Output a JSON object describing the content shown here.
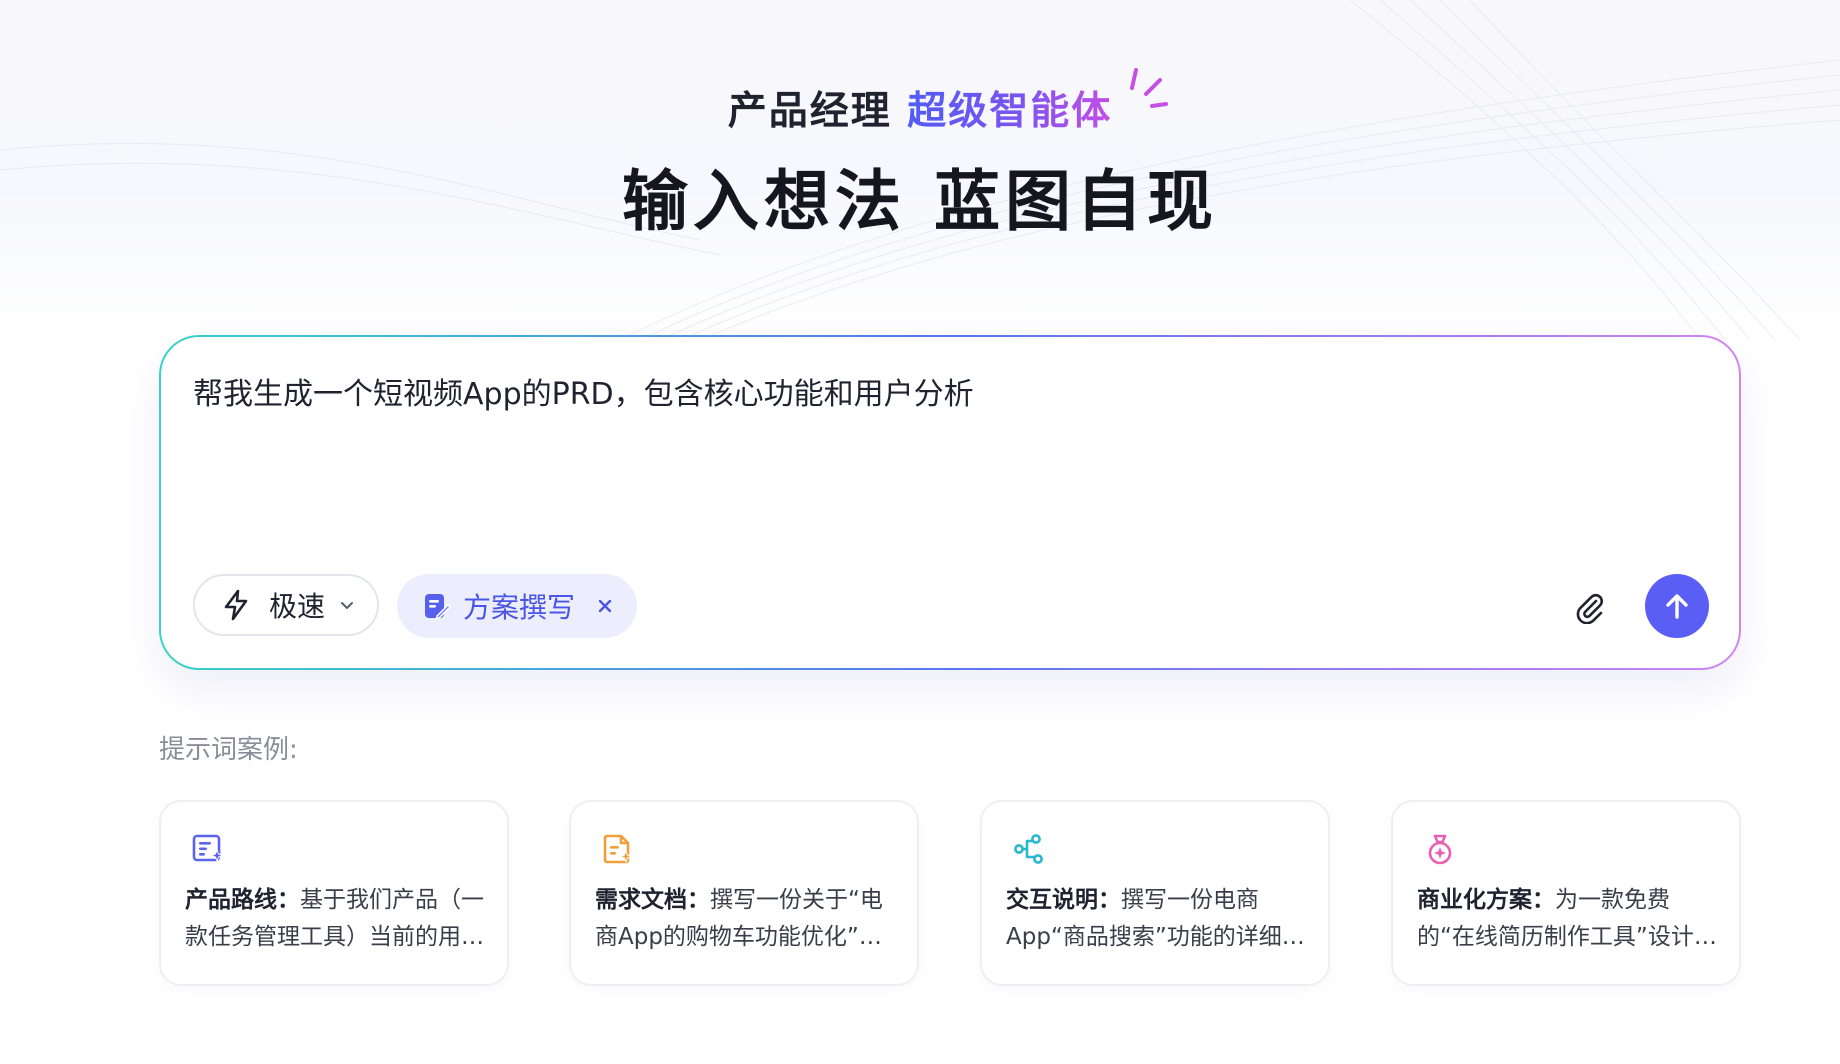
{
  "hero": {
    "subtitle_plain": "产品经理",
    "subtitle_highlight": "超级智能体",
    "title": "输入想法 蓝图自现"
  },
  "input": {
    "value": "帮我生成一个短视频App的PRD，包含核心功能和用户分析",
    "speed_mode_label": "极速",
    "tag_label": "方案撰写",
    "icons": {
      "speed": "lightning-icon",
      "tag": "document-edit-icon",
      "attach": "paperclip-icon",
      "send": "arrow-up-icon"
    },
    "send_color": "#5b5ef4"
  },
  "examples": {
    "label": "提示词案例:",
    "cards": [
      {
        "title": "产品路线",
        "sep": "：",
        "body": "基于我们产品（一款任务管理工具）当前的用户反馈和市场竞争情况，制定产品路线图",
        "icon": "roadmap-icon",
        "color": "#5c63f0"
      },
      {
        "title": "需求文档",
        "sep": "：",
        "body": "撰写一份关于“电商App的购物车功能优化”的需求文档",
        "icon": "document-icon",
        "color": "#f0a03a"
      },
      {
        "title": "交互说明",
        "sep": "：",
        "body": "撰写一份电商App“商品搜索”功能的详细交互说明",
        "icon": "flow-icon",
        "color": "#27b7cf"
      },
      {
        "title": "商业化方案",
        "sep": "：",
        "body": "为一款免费的“在线简历制作工具”设计商业化方案",
        "icon": "moneybag-icon",
        "color": "#ec5fb0"
      }
    ]
  }
}
